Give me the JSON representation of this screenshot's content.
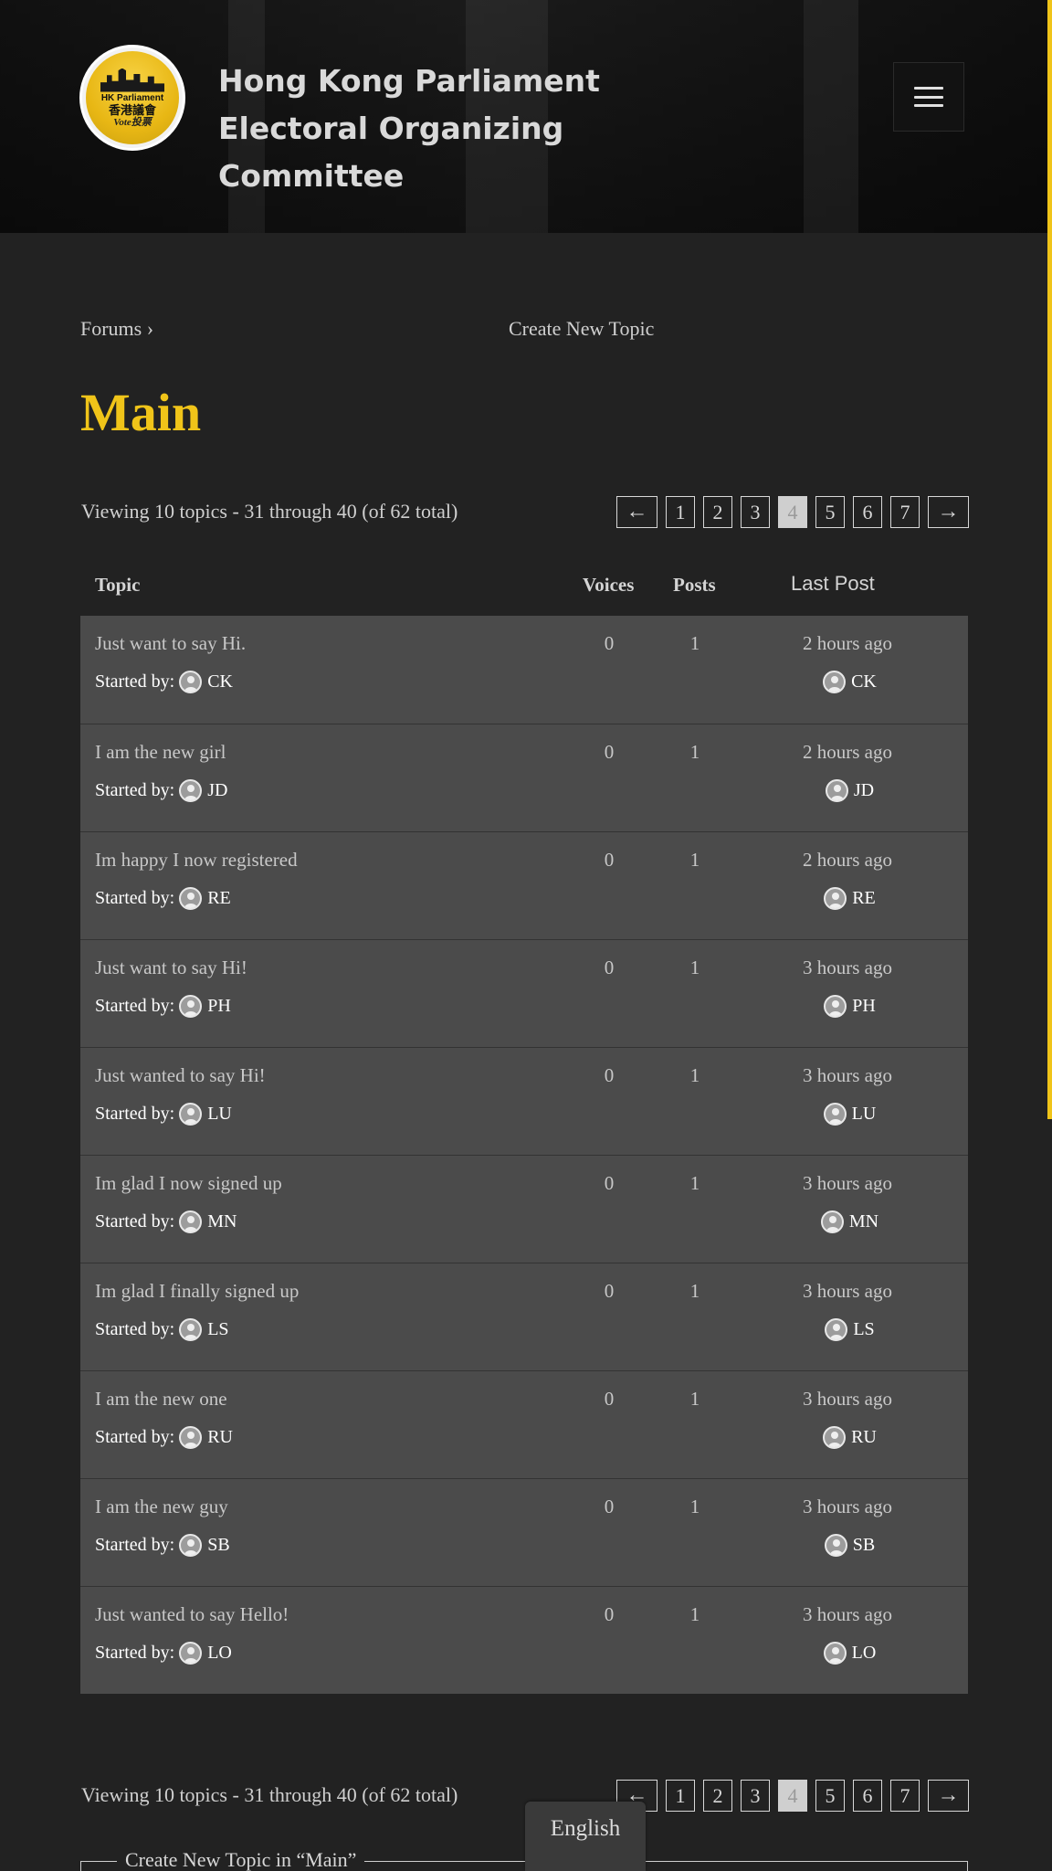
{
  "header": {
    "logo": {
      "line1": "HK Parliament",
      "line2": "香港議會",
      "line3": "Vote投票"
    },
    "site_title": "Hong Kong Parliament Electoral Organizing Committee",
    "menu_icon": "hamburger-menu-icon"
  },
  "breadcrumb": {
    "forums_label": "Forums",
    "separator": "›"
  },
  "create_new_topic_label": "Create New Topic",
  "forum_title": "Main",
  "viewing_text": "Viewing 10 topics - 31 through 40 (of 62 total)",
  "pagination": {
    "prev": "←",
    "next": "→",
    "pages": [
      "1",
      "2",
      "3",
      "4",
      "5",
      "6",
      "7"
    ],
    "current": "4"
  },
  "table": {
    "headers": {
      "topic": "Topic",
      "voices": "Voices",
      "posts": "Posts",
      "last_post": "Last Post"
    },
    "started_by_label": "Started by:",
    "rows": [
      {
        "title": "Just want to say Hi.",
        "author": "CK",
        "voices": "0",
        "posts": "1",
        "freshness": "2 hours ago",
        "last_author": "CK"
      },
      {
        "title": "I am the new girl",
        "author": "JD",
        "voices": "0",
        "posts": "1",
        "freshness": "2 hours ago",
        "last_author": "JD"
      },
      {
        "title": "Im happy I now registered",
        "author": "RE",
        "voices": "0",
        "posts": "1",
        "freshness": "2 hours ago",
        "last_author": "RE"
      },
      {
        "title": "Just want to say Hi!",
        "author": "PH",
        "voices": "0",
        "posts": "1",
        "freshness": "3 hours ago",
        "last_author": "PH"
      },
      {
        "title": "Just wanted to say Hi!",
        "author": "LU",
        "voices": "0",
        "posts": "1",
        "freshness": "3 hours ago",
        "last_author": "LU"
      },
      {
        "title": "Im glad I now signed up",
        "author": "MN",
        "voices": "0",
        "posts": "1",
        "freshness": "3 hours ago",
        "last_author": "MN"
      },
      {
        "title": "Im glad I finally signed up",
        "author": "LS",
        "voices": "0",
        "posts": "1",
        "freshness": "3 hours ago",
        "last_author": "LS"
      },
      {
        "title": "I am the new one",
        "author": "RU",
        "voices": "0",
        "posts": "1",
        "freshness": "3 hours ago",
        "last_author": "RU"
      },
      {
        "title": "I am the new guy",
        "author": "SB",
        "voices": "0",
        "posts": "1",
        "freshness": "3 hours ago",
        "last_author": "SB"
      },
      {
        "title": "Just wanted to say Hello!",
        "author": "LO",
        "voices": "0",
        "posts": "1",
        "freshness": "3 hours ago",
        "last_author": "LO"
      }
    ]
  },
  "new_topic_legend": "Create New Topic in “Main”",
  "language_button": "English",
  "colors": {
    "accent": "#f0c419",
    "background": "#222222",
    "row_background": "#4b4b4b"
  }
}
